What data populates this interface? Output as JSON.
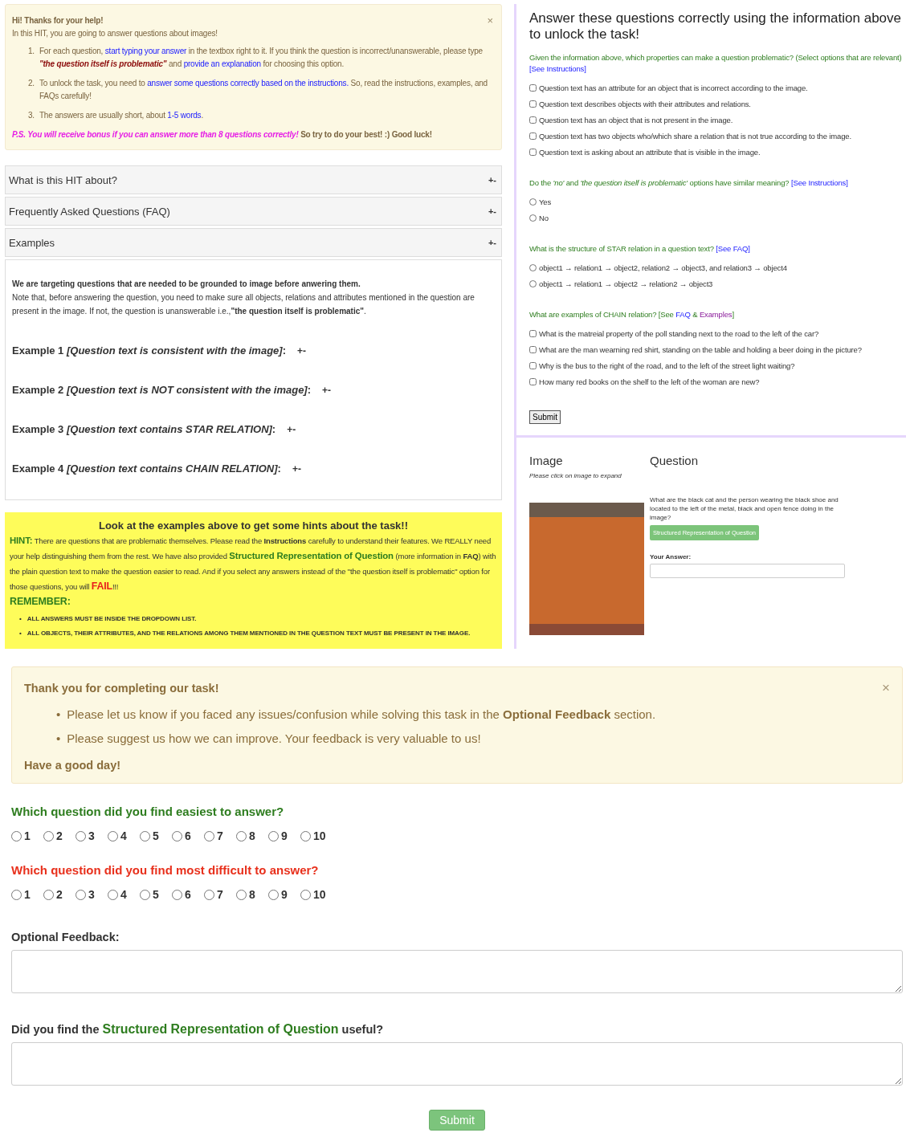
{
  "intro": {
    "title": "Hi! Thanks for your help!",
    "close": "×",
    "subtitle": "In this HIT, you are going to answer questions about images!",
    "items": [
      {
        "marker": "1.",
        "text": [
          {
            "kind": "text",
            "text": "For each question, "
          },
          {
            "kind": "blue",
            "text": "start typing your answer"
          },
          {
            "kind": "text",
            "text": " in the textbox right to it. If you think the question is incorrect/unanswerable, please type "
          },
          {
            "kind": "maroon",
            "text": "\"the question itself is problematic\""
          },
          {
            "kind": "text",
            "text": " and "
          },
          {
            "kind": "blue",
            "text": "provide an explanation"
          },
          {
            "kind": "text",
            "text": " for choosing this option."
          }
        ]
      },
      {
        "marker": "2.",
        "text": [
          {
            "kind": "text",
            "text": "To unlock the task, you need to "
          },
          {
            "kind": "blue",
            "text": "answer some questions correctly based on the instructions."
          },
          {
            "kind": "text",
            "text": " So, read the instructions, examples, and FAQs carefully!"
          }
        ]
      },
      {
        "marker": "3.",
        "text": [
          {
            "kind": "text",
            "text": "The answers are usually short, about "
          },
          {
            "kind": "blue",
            "text": "1-5 words"
          },
          {
            "kind": "text",
            "text": "."
          }
        ]
      }
    ],
    "footer": [
      {
        "kind": "pink",
        "text": "P.S. You will receive bonus if you can answer more than 8 questions correctly!"
      },
      {
        "kind": "bold",
        "text": " So try to do your best! :) Good luck!"
      }
    ]
  },
  "accordions": [
    {
      "title": "What is this HIT about?",
      "toggle": "+-"
    },
    {
      "title": "Frequently Asked Questions (FAQ)",
      "toggle": "+-"
    },
    {
      "title": "Examples",
      "toggle": "+-",
      "lead": "We are targeting questions that are needed to be grounded to image before anwering them.",
      "note": "Note that, before answering the question, you need to make sure all objects, relations and attributes mentioned in the question are present in the image. If not, the question is unanswerable i.e.,**\"the question itself is problematic\"**.",
      "examples": [
        {
          "title": "Example 1 *[Question text is consistent with the image]*:",
          "toggle": "+-"
        },
        {
          "title": "Example 2 *[Question text is NOT consistent with the image]*:",
          "toggle": "+-"
        },
        {
          "title": "Example 3 *[Question text contains STAR RELATION]*:",
          "toggle": "+-"
        },
        {
          "title": "Example 4 *[Question text contains CHAIN RELATION]*:",
          "toggle": "+-"
        }
      ]
    }
  ],
  "hint": {
    "title": "Look at the examples above to get some hints about the task!!",
    "paragraph": [
      {
        "kind": "green",
        "text": "HINT:"
      },
      {
        "kind": "text",
        "text": " There are questions that are problematic themselves. Please read the "
      },
      {
        "kind": "bold",
        "text": "Instructions"
      },
      {
        "kind": "text",
        "text": " carefully to understand their features. We REALLY need your help distinguishing them from the rest. We have also provided "
      },
      {
        "kind": "green",
        "text": "Structured Representation of Question"
      },
      {
        "kind": "text",
        "text": " (more information in "
      },
      {
        "kind": "bold",
        "text": "FAQ"
      },
      {
        "kind": "text",
        "text": ") with the plain question text to make the question easier to read. And if you select any answers instead of the \"the question itself is problematic\" option for those questions, you will "
      },
      {
        "kind": "red",
        "text": "FAIL"
      },
      {
        "kind": "text",
        "text": "!!!"
      }
    ],
    "remember": "REMEMBER:",
    "bullet": "•",
    "rules": [
      "ALL ANSWERS MUST BE INSIDE THE DROPDOWN LIST.",
      "ALL OBJECTS, THEIR ATTRIBUTES, AND THE RELATIONS AMONG THEM MENTIONED IN THE QUESTION TEXT MUST BE PRESENT IN THE IMAGE."
    ]
  },
  "quiz": {
    "title": "Answer these questions correctly using the information above to unlock the task!",
    "questions": [
      {
        "kind": "checkbox",
        "prompt": [
          {
            "kind": "text",
            "text": "Given the information above, which properties can make a question problematic? (Select options that are relevant) "
          },
          {
            "kind": "link",
            "text": "[See Instructions]"
          }
        ],
        "options": [
          {
            "label": "Question text has an attribute for an object that is incorrect according to the image.",
            "checked": false
          },
          {
            "label": "Question text describes objects with their attributes and relations.",
            "checked": false
          },
          {
            "label": "Question text has an object that is not present in the image.",
            "checked": false
          },
          {
            "label": "Question text has two objects who/which share a relation that is not true according to the image.",
            "checked": false
          },
          {
            "label": "Question text is asking about an attribute that is visible in the image.",
            "checked": false
          }
        ]
      },
      {
        "kind": "radio",
        "prompt": [
          {
            "kind": "text",
            "text": "Do the *'no'* and *'the question itself is problematic'* options have similar meaning? "
          },
          {
            "kind": "link",
            "text": "[See Instructions]"
          }
        ],
        "options": [
          {
            "label": "Yes",
            "selected": false
          },
          {
            "label": "No",
            "selected": false
          }
        ]
      },
      {
        "kind": "radio",
        "prompt": [
          {
            "kind": "text",
            "text": "What is the structure of STAR relation in a question text? "
          },
          {
            "kind": "link",
            "text": "[See FAQ]"
          }
        ],
        "options": [
          {
            "label": "object1 → relation1 → object2, relation2 → object3, and relation3 → object4",
            "selected": false
          },
          {
            "label": "object1 → relation1 → object2 → relation2 → object3",
            "selected": false
          }
        ]
      },
      {
        "kind": "checkbox",
        "prompt": [
          {
            "kind": "text",
            "text": "What are examples of CHAIN relation? [See "
          },
          {
            "kind": "link",
            "text": "FAQ"
          },
          {
            "kind": "text",
            "text": " & "
          },
          {
            "kind": "visited-link",
            "text": "Examples"
          },
          {
            "kind": "text",
            "text": "]"
          }
        ],
        "options": [
          {
            "label": "What is the matreial property of the poll standing next to the road to the left of the car?",
            "checked": false
          },
          {
            "label": "What are the man wearning red shirt, standing on the table and holding a beer doing in the picture?",
            "checked": false
          },
          {
            "label": "Why is the bus to the right of the road, and to the left of the street light waiting?",
            "checked": false
          },
          {
            "label": "How many red books on the shelf to the left of the woman are new?",
            "checked": false
          }
        ]
      }
    ],
    "submit": "Submit"
  },
  "task": {
    "image_heading": "Image",
    "image_hint": "Please click on image to expand",
    "question_heading": "Question",
    "question": "What are the black cat and the person wearing the black shoe and located to the left of the metal, black and open fence doing in the image?",
    "structure_button": "Structured Representation of Question",
    "answer_label": "Your Answer:"
  },
  "notice": {
    "title": "Thank you for completing our task!",
    "close": "×",
    "bullet": "•",
    "bullets": [
      "Please let us know if you faced any issues/confusion while solving this task in the **Optional Feedback** section.",
      "Please suggest us how we can improve. Your feedback is very valuable to us!"
    ],
    "closing": "Have a good day!"
  },
  "ratings": [
    {
      "question": "Which question did you find easiest to answer?",
      "color": "#2e7d1f",
      "options": [
        {
          "label": "1",
          "selected": false
        },
        {
          "label": "2",
          "selected": false
        },
        {
          "label": "3",
          "selected": false
        },
        {
          "label": "4",
          "selected": false
        },
        {
          "label": "5",
          "selected": false
        },
        {
          "label": "6",
          "selected": false
        },
        {
          "label": "7",
          "selected": false
        },
        {
          "label": "8",
          "selected": false
        },
        {
          "label": "9",
          "selected": false
        },
        {
          "label": "10",
          "selected": false
        }
      ]
    },
    {
      "question": "Which question did you find most difficult to answer?",
      "color": "#e8301c",
      "options": [
        {
          "label": "1",
          "selected": false
        },
        {
          "label": "2",
          "selected": false
        },
        {
          "label": "3",
          "selected": false
        },
        {
          "label": "4",
          "selected": false
        },
        {
          "label": "5",
          "selected": false
        },
        {
          "label": "6",
          "selected": false
        },
        {
          "label": "7",
          "selected": false
        },
        {
          "label": "8",
          "selected": false
        },
        {
          "label": "9",
          "selected": false
        },
        {
          "label": "10",
          "selected": false
        }
      ]
    }
  ],
  "feedback_fields": [
    {
      "label": [
        {
          "kind": "text",
          "text": "Optional Feedback:"
        }
      ]
    },
    {
      "label": [
        {
          "kind": "text",
          "text": "Did you find the "
        },
        {
          "kind": "green",
          "text": "Structured Representation of Question"
        },
        {
          "kind": "text",
          "text": " useful?"
        }
      ]
    }
  ],
  "submit": "Submit"
}
